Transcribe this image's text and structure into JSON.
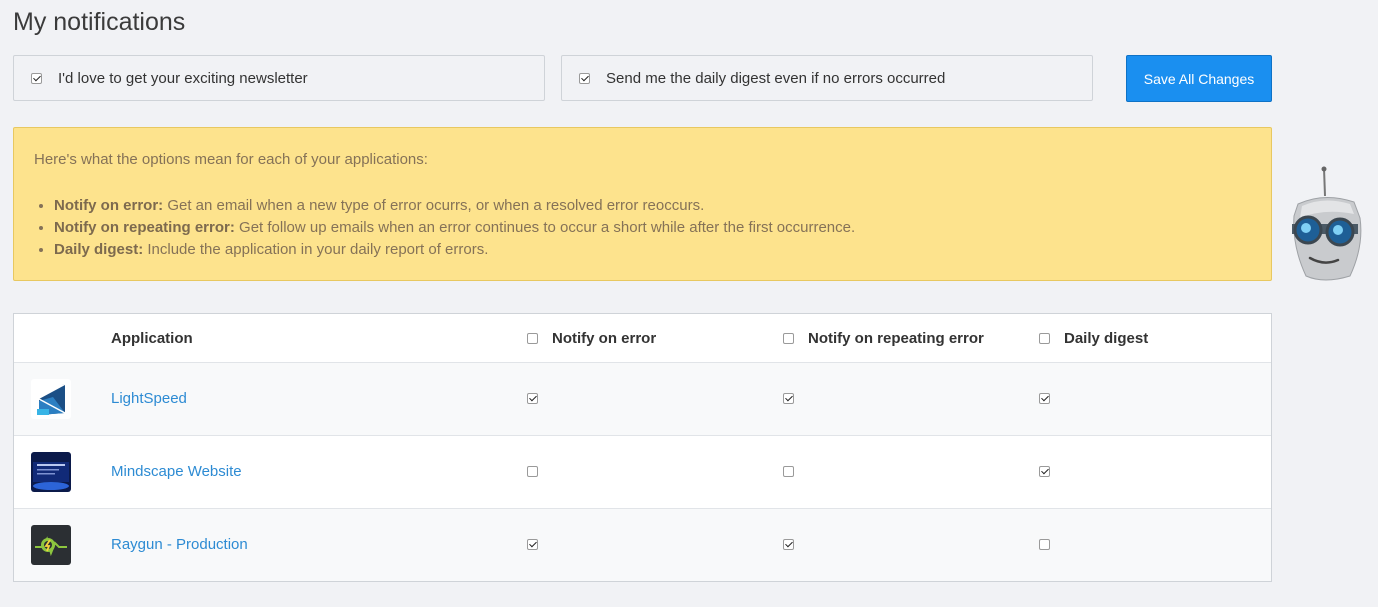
{
  "page": {
    "title": "My notifications"
  },
  "options": {
    "newsletter": {
      "label": "I'd love to get your exciting newsletter",
      "checked": true
    },
    "daily_digest_always": {
      "label": "Send me the daily digest even if no errors occurred",
      "checked": true
    }
  },
  "save_button": {
    "label": "Save All Changes"
  },
  "info": {
    "intro": "Here's what the options mean for each of your applications:",
    "items": [
      {
        "term": "Notify on error:",
        "desc": " Get an email when a new type of error ocurrs, or when a resolved error reoccurs."
      },
      {
        "term": "Notify on repeating error:",
        "desc": " Get follow up emails when an error continues to occur a short while after the first occurrence."
      },
      {
        "term": "Daily digest:",
        "desc": " Include the application in your daily report of errors."
      }
    ]
  },
  "table": {
    "headers": {
      "application": "Application",
      "notify_on_error": "Notify on error",
      "notify_on_repeating_error": "Notify on repeating error",
      "daily_digest": "Daily digest"
    },
    "rows": [
      {
        "name": "LightSpeed",
        "icon": "lightspeed-app-icon",
        "notify_on_error": true,
        "notify_on_repeating_error": true,
        "daily_digest": true
      },
      {
        "name": "Mindscape Website",
        "icon": "mindscape-app-icon",
        "notify_on_error": false,
        "notify_on_repeating_error": false,
        "daily_digest": true
      },
      {
        "name": "Raygun - Production",
        "icon": "raygun-app-icon",
        "notify_on_error": true,
        "notify_on_repeating_error": true,
        "daily_digest": false
      }
    ]
  },
  "colors": {
    "accent": "#1a8ff0",
    "info_bg": "#fde38d",
    "link": "#2d8bd3"
  }
}
